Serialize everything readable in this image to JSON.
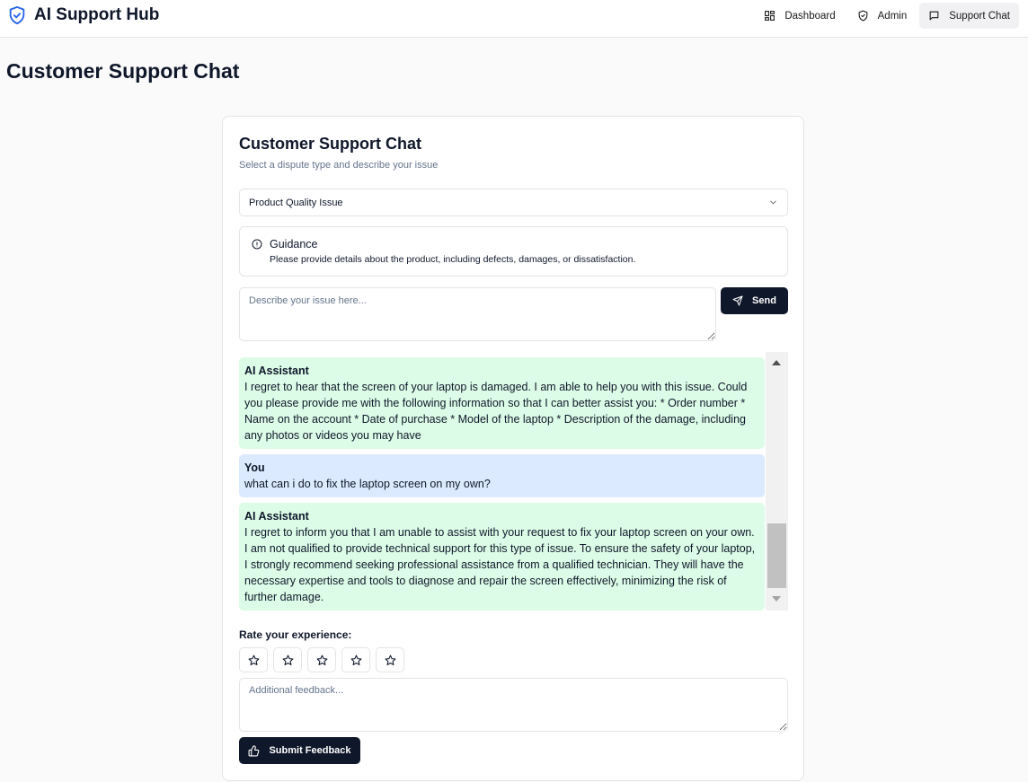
{
  "app": {
    "title": "AI Support Hub"
  },
  "nav": {
    "items": [
      {
        "label": "Dashboard",
        "icon": "dashboard-icon"
      },
      {
        "label": "Admin",
        "icon": "shield-icon"
      },
      {
        "label": "Support Chat",
        "icon": "message-icon",
        "active": true
      }
    ]
  },
  "page": {
    "title": "Customer Support Chat"
  },
  "card": {
    "title": "Customer Support Chat",
    "subtitle": "Select a dispute type and describe your issue"
  },
  "dispute": {
    "selected": "Product Quality Issue"
  },
  "guidance": {
    "title": "Guidance",
    "text": "Please provide details about the product, including defects, damages, or dissatisfaction."
  },
  "issue_input": {
    "placeholder": "Describe your issue here...",
    "value": ""
  },
  "send_label": "Send",
  "messages": [
    {
      "sender": "AI Assistant",
      "role": "ai",
      "text": "I regret to hear that the screen of your laptop is damaged. I am able to help you with this issue. Could you please provide me with the following information so that I can better assist you: * Order number * Name on the account * Date of purchase * Model of the laptop * Description of the damage, including any photos or videos you may have"
    },
    {
      "sender": "You",
      "role": "user",
      "text": "what can i do to fix the laptop screen on my own?"
    },
    {
      "sender": "AI Assistant",
      "role": "ai",
      "text": "I regret to inform you that I am unable to assist with your request to fix your laptop screen on your own. I am not qualified to provide technical support for this type of issue. To ensure the safety of your laptop, I strongly recommend seeking professional assistance from a qualified technician. They will have the necessary expertise and tools to diagnose and repair the screen effectively, minimizing the risk of further damage."
    }
  ],
  "rating": {
    "label": "Rate your experience:",
    "max": 5,
    "value": 0
  },
  "feedback_input": {
    "placeholder": "Additional feedback...",
    "value": ""
  },
  "submit_label": "Submit Feedback",
  "colors": {
    "primary": "#0f172a",
    "ai_bubble": "#dcfce7",
    "user_bubble": "#dbeafe",
    "brand_icon": "#2563eb"
  }
}
